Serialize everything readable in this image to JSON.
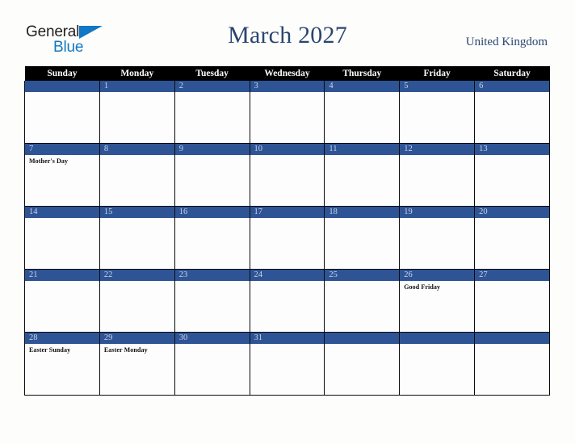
{
  "brand": {
    "name_part1": "General",
    "name_part2": "Blue",
    "triangle_icon": "triangle-icon",
    "color_dark": "#231f20",
    "color_blue": "#1277c4"
  },
  "header": {
    "title": "March 2027",
    "country": "United Kingdom",
    "title_color": "#2b4570"
  },
  "calendar": {
    "accent_blue": "#2e5496",
    "header_bg": "#000000",
    "weekday_headers": [
      "Sunday",
      "Monday",
      "Tuesday",
      "Wednesday",
      "Thursday",
      "Friday",
      "Saturday"
    ],
    "weeks": [
      [
        {
          "day": "",
          "holiday": ""
        },
        {
          "day": "1",
          "holiday": ""
        },
        {
          "day": "2",
          "holiday": ""
        },
        {
          "day": "3",
          "holiday": ""
        },
        {
          "day": "4",
          "holiday": ""
        },
        {
          "day": "5",
          "holiday": ""
        },
        {
          "day": "6",
          "holiday": ""
        }
      ],
      [
        {
          "day": "7",
          "holiday": "Mother's Day"
        },
        {
          "day": "8",
          "holiday": ""
        },
        {
          "day": "9",
          "holiday": ""
        },
        {
          "day": "10",
          "holiday": ""
        },
        {
          "day": "11",
          "holiday": ""
        },
        {
          "day": "12",
          "holiday": ""
        },
        {
          "day": "13",
          "holiday": ""
        }
      ],
      [
        {
          "day": "14",
          "holiday": ""
        },
        {
          "day": "15",
          "holiday": ""
        },
        {
          "day": "16",
          "holiday": ""
        },
        {
          "day": "17",
          "holiday": ""
        },
        {
          "day": "18",
          "holiday": ""
        },
        {
          "day": "19",
          "holiday": ""
        },
        {
          "day": "20",
          "holiday": ""
        }
      ],
      [
        {
          "day": "21",
          "holiday": ""
        },
        {
          "day": "22",
          "holiday": ""
        },
        {
          "day": "23",
          "holiday": ""
        },
        {
          "day": "24",
          "holiday": ""
        },
        {
          "day": "25",
          "holiday": ""
        },
        {
          "day": "26",
          "holiday": "Good Friday"
        },
        {
          "day": "27",
          "holiday": ""
        }
      ],
      [
        {
          "day": "28",
          "holiday": "Easter Sunday"
        },
        {
          "day": "29",
          "holiday": "Easter Monday"
        },
        {
          "day": "30",
          "holiday": ""
        },
        {
          "day": "31",
          "holiday": ""
        },
        {
          "day": "",
          "holiday": ""
        },
        {
          "day": "",
          "holiday": ""
        },
        {
          "day": "",
          "holiday": ""
        }
      ]
    ]
  }
}
